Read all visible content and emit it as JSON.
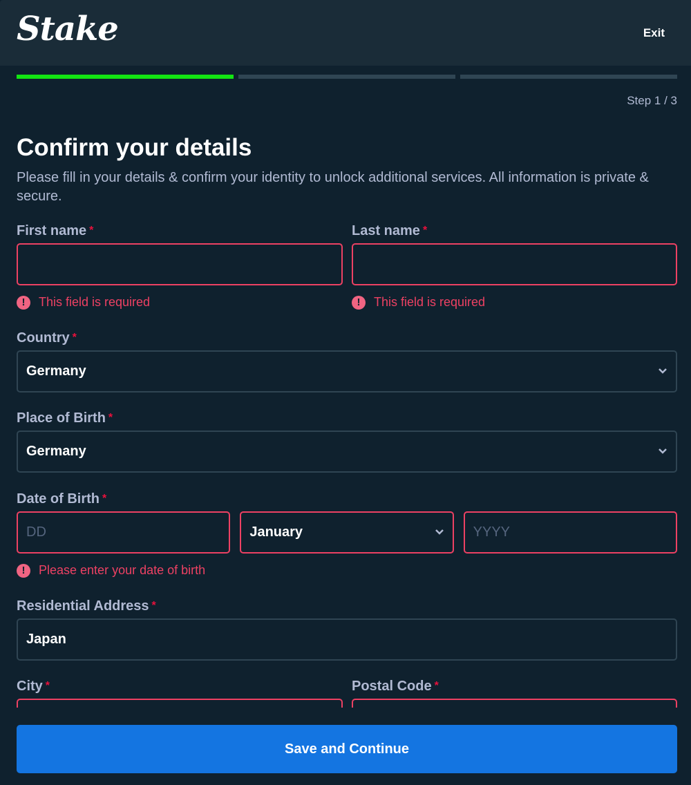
{
  "header": {
    "logo_text": "Stake",
    "exit_label": "Exit"
  },
  "progress": {
    "steps_total": 3,
    "steps_completed": 1,
    "step_label": "Step 1 / 3",
    "active_color": "#13e513",
    "inactive_color": "#2f4553"
  },
  "page": {
    "title": "Confirm your details",
    "subtitle": "Please fill in your details & confirm your identity to unlock additional services. All information is private & secure."
  },
  "form": {
    "required_marker": "*",
    "first_name": {
      "label": "First name",
      "value": "",
      "error": "This field is required"
    },
    "last_name": {
      "label": "Last name",
      "value": "",
      "error": "This field is required"
    },
    "country": {
      "label": "Country",
      "value": "Germany"
    },
    "place_of_birth": {
      "label": "Place of Birth",
      "value": "Germany"
    },
    "date_of_birth": {
      "label": "Date of Birth",
      "day_placeholder": "DD",
      "month_value": "January",
      "year_placeholder": "YYYY",
      "error": "Please enter your date of birth"
    },
    "residential_address": {
      "label": "Residential Address",
      "value": "Japan"
    },
    "city": {
      "label": "City",
      "value": ""
    },
    "postal_code": {
      "label": "Postal Code",
      "value": ""
    }
  },
  "footer": {
    "save_label": "Save and Continue",
    "button_color": "#1475e1"
  },
  "colors": {
    "error": "#ed4163",
    "required": "#e9113c",
    "background": "#0f212e",
    "header_bg": "#1a2c38"
  }
}
